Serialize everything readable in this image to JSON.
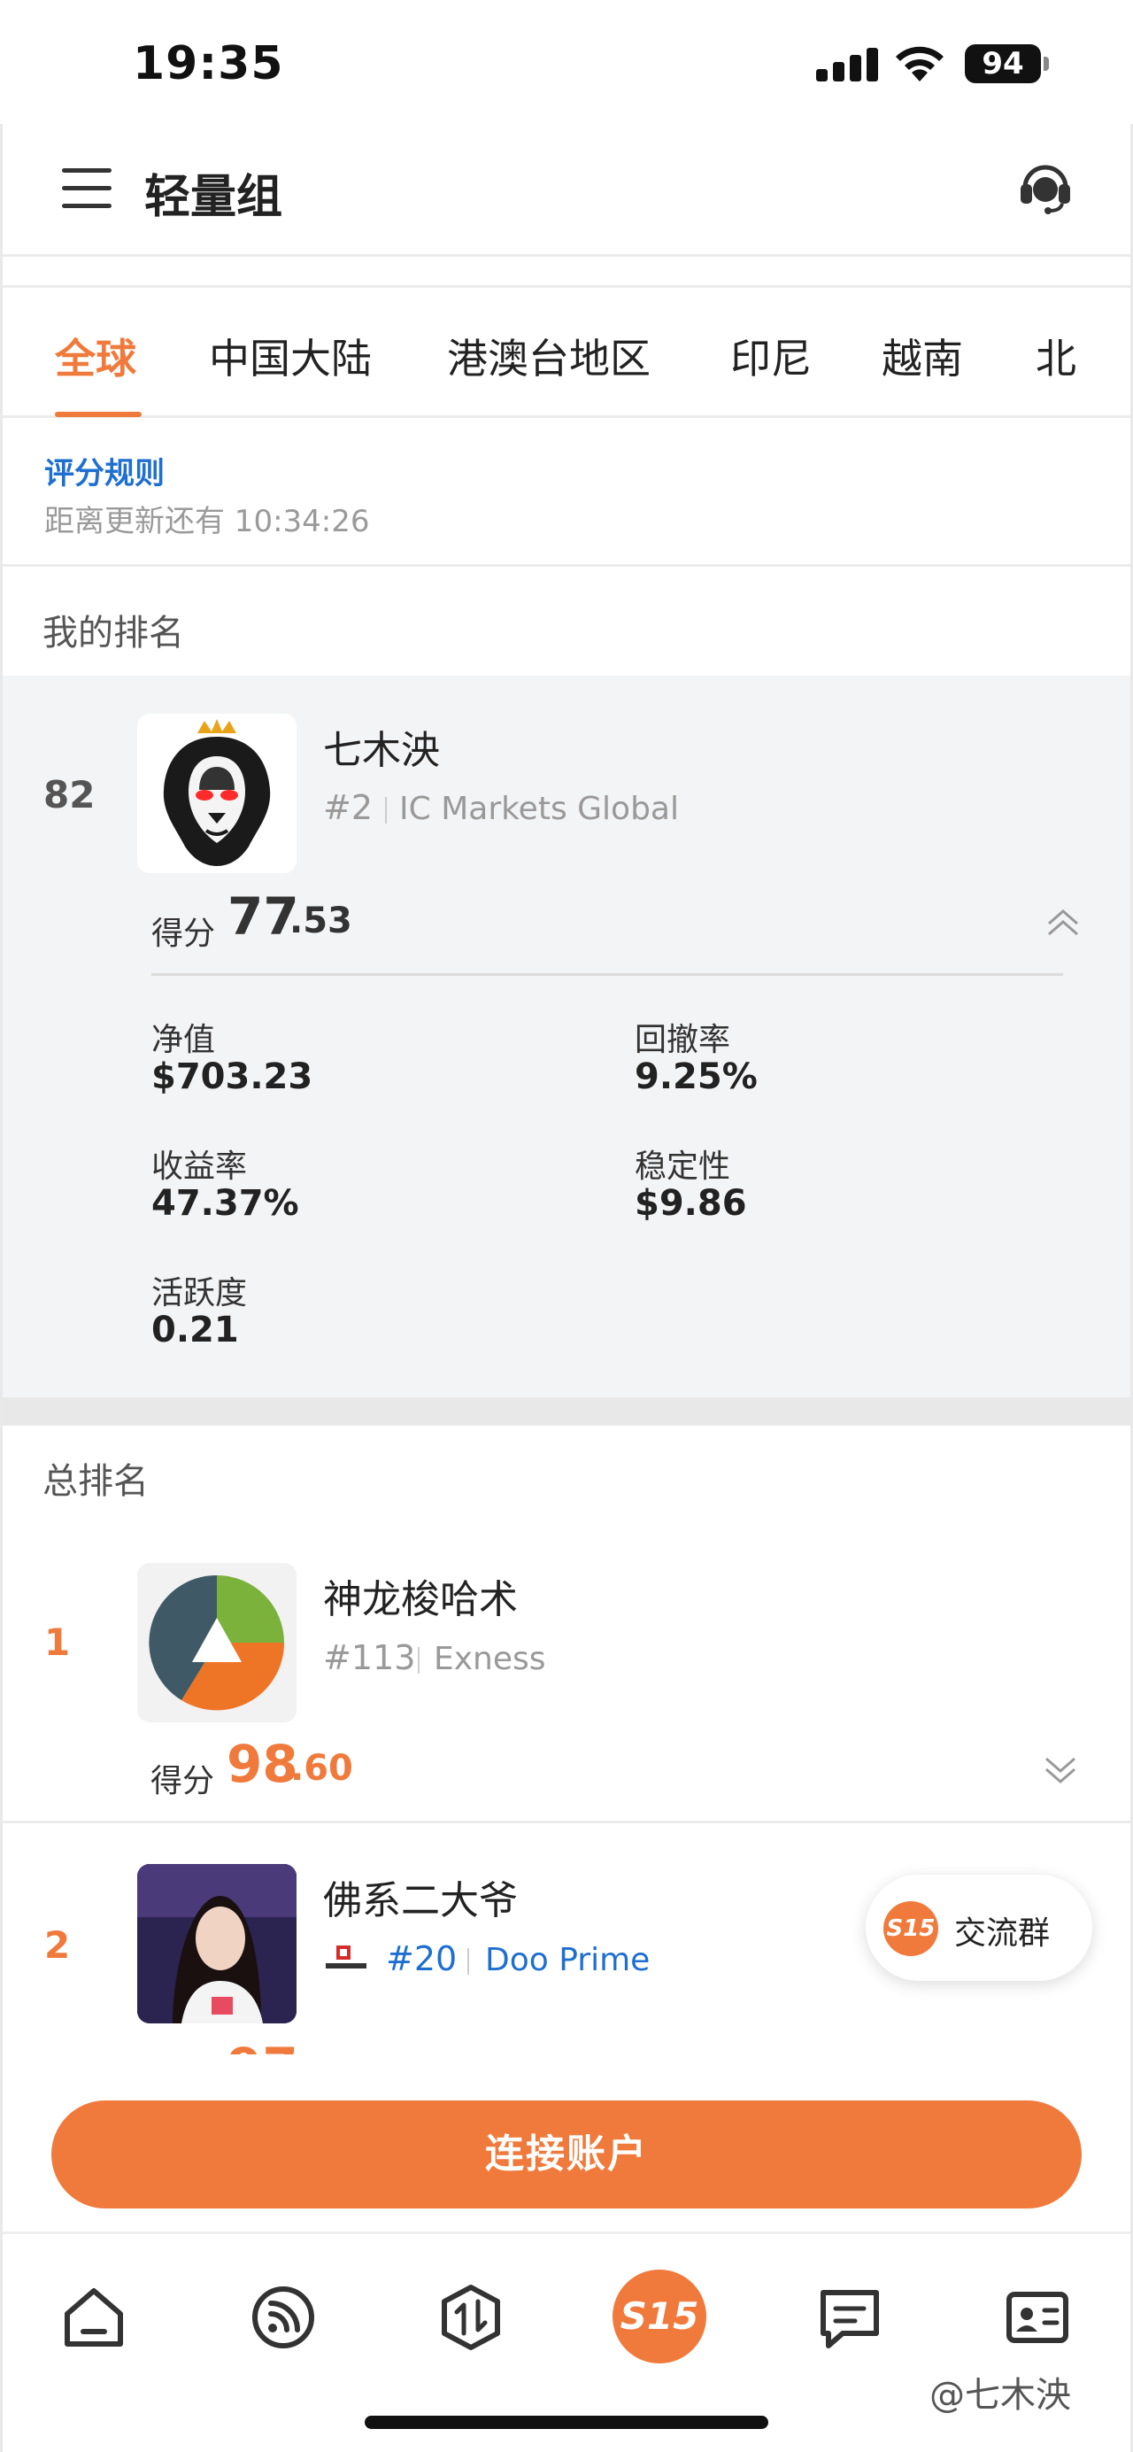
{
  "status_bar": {
    "time": "19:35",
    "battery": "94"
  },
  "header": {
    "title": "轻量组"
  },
  "tabs": [
    {
      "label": "全球",
      "active": true
    },
    {
      "label": "中国大陆",
      "active": false
    },
    {
      "label": "港澳台地区",
      "active": false
    },
    {
      "label": "印尼",
      "active": false
    },
    {
      "label": "越南",
      "active": false
    },
    {
      "label": "北",
      "active": false
    }
  ],
  "rules": {
    "link": "评分规则",
    "countdown": "距离更新还有 10:34:26"
  },
  "my_rank": {
    "section_title": "我的排名",
    "rank": "82",
    "name": "七木泱",
    "account_rank": "#2",
    "broker": "IC Markets Global",
    "score_label": "得分",
    "score_int": "77",
    "score_dec": ".53",
    "metrics": [
      {
        "label": "净值",
        "value": "$703.23"
      },
      {
        "label": "回撤率",
        "value": "9.25%"
      },
      {
        "label": "收益率",
        "value": "47.37%"
      },
      {
        "label": "稳定性",
        "value": "$9.86"
      },
      {
        "label": "活跃度",
        "value": "0.21"
      }
    ]
  },
  "leaderboard": {
    "section_title": "总排名",
    "rows": [
      {
        "rank": "1",
        "name": "神龙梭哈术",
        "account_rank": "#113",
        "broker": "Exness",
        "score_label": "得分",
        "score_int": "98",
        "score_dec": ".60"
      },
      {
        "rank": "2",
        "name": "佛系二大爷",
        "account_rank": "#20",
        "broker": "Doo Prime",
        "broker_logo_text": "Doo Prime"
      }
    ]
  },
  "chat": {
    "logo": "S15",
    "label": "交流群"
  },
  "connect_button": "连接账户",
  "tabbar": {
    "center_label": "S15"
  },
  "watermark": "@七木泱",
  "colors": {
    "accent": "#f07a3c",
    "link": "#1e6fd0",
    "muted": "#999999"
  }
}
